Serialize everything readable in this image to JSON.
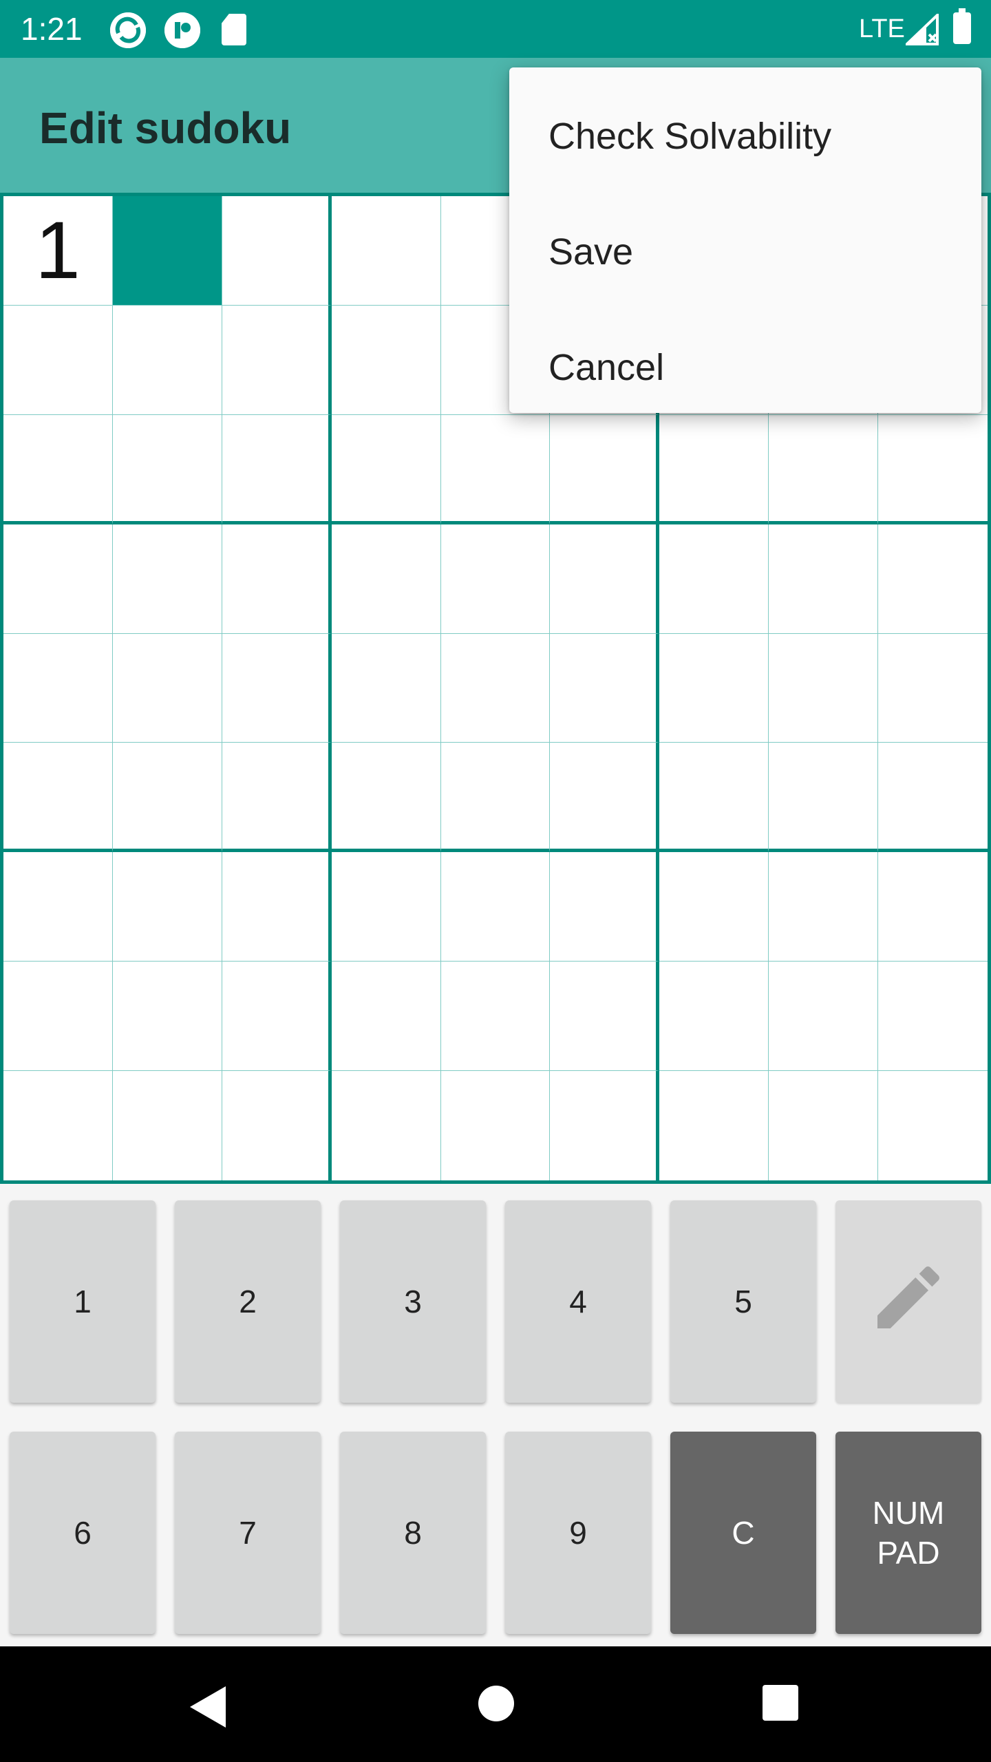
{
  "status_bar": {
    "time": "1:21",
    "network": "LTE",
    "icons": [
      "sync-icon",
      "app-notification-icon",
      "sd-card-icon",
      "signal-icon",
      "battery-icon"
    ]
  },
  "app_bar": {
    "title": "Edit sudoku"
  },
  "grid": {
    "cells": [
      [
        "1",
        "",
        "",
        "",
        "",
        "",
        "",
        "",
        ""
      ],
      [
        "",
        "",
        "",
        "",
        "",
        "",
        "",
        "",
        ""
      ],
      [
        "",
        "",
        "",
        "",
        "",
        "",
        "",
        "",
        ""
      ],
      [
        "",
        "",
        "",
        "",
        "",
        "",
        "",
        "",
        ""
      ],
      [
        "",
        "",
        "",
        "",
        "",
        "",
        "",
        "",
        ""
      ],
      [
        "",
        "",
        "",
        "",
        "",
        "",
        "",
        "",
        ""
      ],
      [
        "",
        "",
        "",
        "",
        "",
        "",
        "",
        "",
        ""
      ],
      [
        "",
        "",
        "",
        "",
        "",
        "",
        "",
        "",
        ""
      ],
      [
        "",
        "",
        "",
        "",
        "",
        "",
        "",
        "",
        ""
      ]
    ],
    "selected_cell": {
      "row": 1,
      "col": 2
    }
  },
  "menu": {
    "items": [
      "Check Solvability",
      "Save",
      "Cancel"
    ]
  },
  "keypad": {
    "keys": [
      "1",
      "2",
      "3",
      "4",
      "5",
      "",
      "6",
      "7",
      "8",
      "9",
      "C",
      "NUM\nPAD"
    ],
    "pencil_icon": "pencil-icon"
  },
  "nav_bar": {
    "icons": [
      "back-icon",
      "home-icon",
      "recents-icon"
    ]
  },
  "colors": {
    "status_bar": "#009688",
    "app_bar": "#4db6ac",
    "grid_thick": "#00897b",
    "grid_thin": "#80cbc4",
    "selected_cell": "#009688",
    "key": "#d6d7d7",
    "key_dark": "#666666"
  }
}
